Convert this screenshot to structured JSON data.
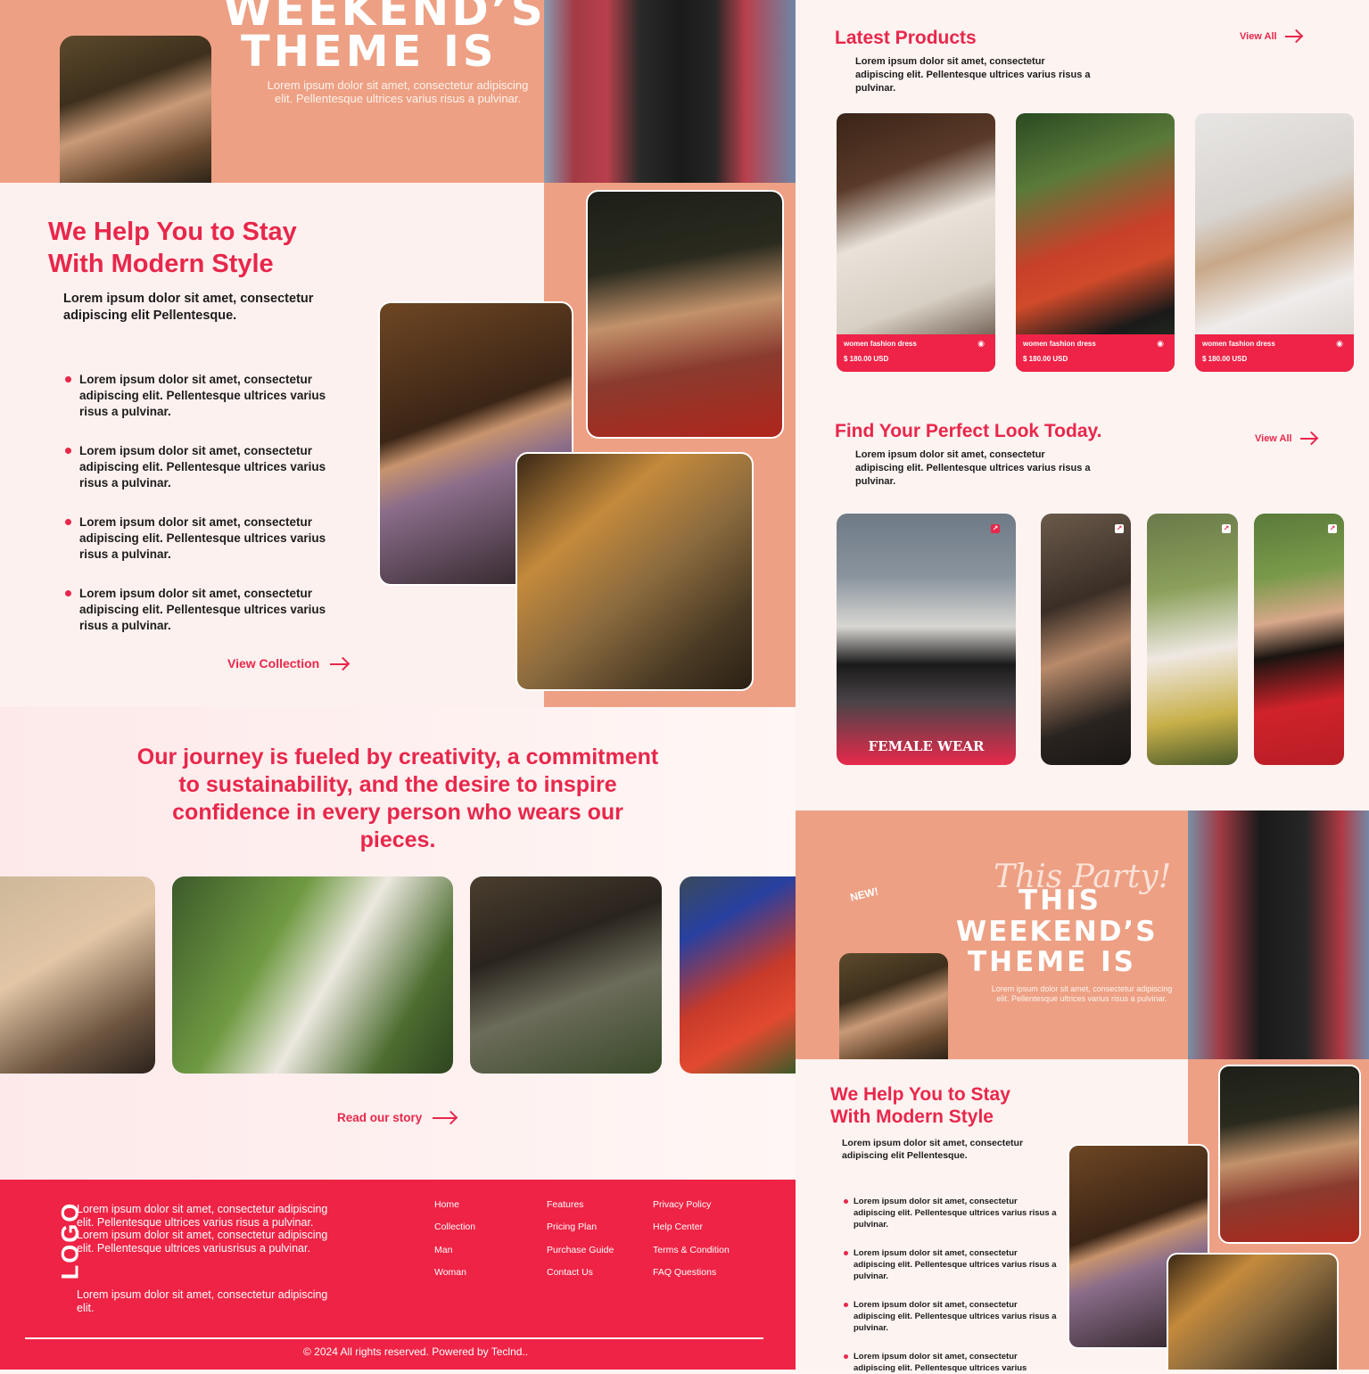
{
  "hero": {
    "title_line1": "WEEKEND’S",
    "title_line2": "THEME IS",
    "desc": "Lorem ipsum dolor sit amet, consectetur adipiscing elit. Pellentesque ultrices varius risus a pulvinar."
  },
  "style_section": {
    "heading_line1": "We Help You to Stay",
    "heading_line2": "With Modern Style",
    "intro": "Lorem ipsum dolor sit amet, consectetur adipiscing elit Pellentesque.",
    "bullets": [
      "Lorem ipsum dolor sit amet, consectetur adipiscing elit. Pellentesque ultrices varius risus a pulvinar.",
      "Lorem ipsum dolor sit amet, consectetur adipiscing elit. Pellentesque ultrices varius risus a pulvinar.",
      "Lorem ipsum dolor sit amet, consectetur adipiscing elit. Pellentesque ultrices varius risus a pulvinar.",
      "Lorem ipsum dolor sit amet, consectetur adipiscing elit. Pellentesque ultrices varius risus a pulvinar."
    ],
    "cta": "View Collection"
  },
  "journey": {
    "quote": "Our journey is fueled by creativity, a commitment to sustainability, and the desire to inspire confidence in every person who wears our pieces.",
    "cta": "Read our story"
  },
  "footer": {
    "logo": "LOGO",
    "desc1": "Lorem ipsum dolor sit amet, consectetur adipiscing elit. Pellentesque ultrices varius risus a pulvinar. Lorem ipsum dolor sit amet, consectetur adipiscing elit. Pellentesque ultrices variusrisus a pulvinar.",
    "desc2": "Lorem ipsum dolor sit amet, consectetur adipiscing elit.",
    "col1": [
      "Home",
      "Collection",
      "Man",
      "Woman"
    ],
    "col2": [
      "Features",
      "Pricing Plan",
      "Purchase Guide",
      "Contact Us"
    ],
    "col3": [
      "Privacy Policy",
      "Help Center",
      "Terms & Condition",
      "FAQ Questions"
    ],
    "copyright": "© 2024 All rights reserved. Powered by Teclnd.."
  },
  "latest": {
    "title": "Latest Products",
    "view_all": "View All",
    "desc": "Lorem ipsum dolor sit amet, consectetur adipiscing elit. Pellentesque ultrices varius risus a pulvinar.",
    "products": [
      {
        "name": "women fashion dress",
        "price": "$ 180.00  USD"
      },
      {
        "name": "women fashion dress",
        "price": "$ 180.00  USD"
      },
      {
        "name": "women fashion dress",
        "price": "$ 180.00  USD"
      }
    ]
  },
  "look": {
    "title": "Find Your Perfect Look Today.",
    "view_all": "View All",
    "desc": "Lorem ipsum dolor sit amet, consectetur adipiscing elit. Pellentesque ultrices varius risus a pulvinar.",
    "card_label": "FEMALE WEAR"
  },
  "party": {
    "new_badge": "NEW!",
    "script": "This Party!",
    "line1": "THIS",
    "line2": "WEEKEND’S",
    "line3": "THEME IS",
    "desc": "Lorem ipsum dolor sit amet, consectetur adipiscing elit. Pellentesque ultrices varius risus a pulvinar."
  },
  "style_small": {
    "heading_line1": "We Help You to Stay",
    "heading_line2": "With Modern Style",
    "intro": "Lorem ipsum dolor sit amet, consectetur adipiscing elit Pellentesque.",
    "bullets": [
      "Lorem ipsum dolor sit amet, consectetur adipiscing elit. Pellentesque ultrices varius risus a pulvinar.",
      "Lorem ipsum dolor sit amet, consectetur adipiscing elit. Pellentesque ultrices varius risus a pulvinar.",
      "Lorem ipsum dolor sit amet, consectetur adipiscing elit. Pellentesque ultrices varius risus a pulvinar.",
      "Lorem ipsum dolor sit amet, consectetur adipiscing elit. Pellentesque ultrices varius"
    ]
  },
  "colors": {
    "accent": "#e8274b",
    "salmon": "#eda084",
    "footer": "#ef2345"
  }
}
